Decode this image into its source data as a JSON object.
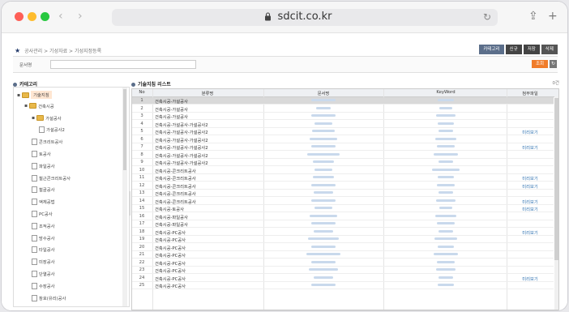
{
  "browser": {
    "url": "sdcit.co.kr"
  },
  "breadcrumb": [
    "공사관리",
    "기성자료",
    "기성지정등록"
  ],
  "top_buttons": {
    "category": "카테고리",
    "new": "신규",
    "save": "저장",
    "delete": "삭제"
  },
  "search": {
    "label": "문서명",
    "value": "",
    "search_button": "조회"
  },
  "left_panel": {
    "title": "카테고리"
  },
  "right_panel": {
    "title": "기술지침 리스트",
    "right_text": "0건"
  },
  "tree": [
    {
      "label": "기술지침",
      "level": 0,
      "type": "folder",
      "selected": true
    },
    {
      "label": "건축시공",
      "level": 1,
      "type": "folder"
    },
    {
      "label": "가설공사",
      "level": 2,
      "type": "folder"
    },
    {
      "label": "가설공사2",
      "level": 3,
      "type": "doc"
    },
    {
      "label": "콘크리트공사",
      "level": 2,
      "type": "doc"
    },
    {
      "label": "토공사",
      "level": 2,
      "type": "doc"
    },
    {
      "label": "파일공사",
      "level": 2,
      "type": "doc"
    },
    {
      "label": "철근콘크리트공사",
      "level": 2,
      "type": "doc"
    },
    {
      "label": "철골공사",
      "level": 2,
      "type": "doc"
    },
    {
      "label": "액체공법",
      "level": 2,
      "type": "doc"
    },
    {
      "label": "PC공사",
      "level": 2,
      "type": "doc"
    },
    {
      "label": "조적공사",
      "level": 2,
      "type": "doc"
    },
    {
      "label": "방수공사",
      "level": 2,
      "type": "doc"
    },
    {
      "label": "타일공사",
      "level": 2,
      "type": "doc"
    },
    {
      "label": "미장공사",
      "level": 2,
      "type": "doc"
    },
    {
      "label": "단열공사",
      "level": 2,
      "type": "doc"
    },
    {
      "label": "수장공사",
      "level": 2,
      "type": "doc"
    },
    {
      "label": "창호(유리)공사",
      "level": 2,
      "type": "doc"
    }
  ],
  "grid": {
    "headers": {
      "no": "No",
      "category": "분류명",
      "doc": "문서명",
      "keyword": "KeyWord",
      "attach": "첨부파일"
    },
    "rows": [
      {
        "no": "1",
        "category": "건축시공-가설공사",
        "attach": ""
      },
      {
        "no": "2",
        "category": "건축시공-가설공사",
        "attach": ""
      },
      {
        "no": "3",
        "category": "건축시공-가설공사",
        "attach": ""
      },
      {
        "no": "4",
        "category": "건축시공-가설공사-가설공사2",
        "attach": ""
      },
      {
        "no": "5",
        "category": "건축시공-가설공사-가설공사2",
        "attach": "미리보기"
      },
      {
        "no": "6",
        "category": "건축시공-가설공사-가설공사2",
        "attach": ""
      },
      {
        "no": "7",
        "category": "건축시공-가설공사-가설공사2",
        "attach": "미리보기"
      },
      {
        "no": "8",
        "category": "건축시공-가설공사-가설공사2",
        "attach": ""
      },
      {
        "no": "9",
        "category": "건축시공-가설공사-가설공사2",
        "attach": ""
      },
      {
        "no": "10",
        "category": "건축시공-콘크리트공사",
        "attach": ""
      },
      {
        "no": "11",
        "category": "건축시공-콘크리트공사",
        "attach": "미리보기"
      },
      {
        "no": "12",
        "category": "건축시공-콘크리트공사",
        "attach": "미리보기"
      },
      {
        "no": "13",
        "category": "건축시공-콘크리트공사",
        "attach": ""
      },
      {
        "no": "14",
        "category": "건축시공-콘크리트공사",
        "attach": "미리보기"
      },
      {
        "no": "15",
        "category": "건축시공-토공사",
        "attach": "미리보기"
      },
      {
        "no": "16",
        "category": "건축시공-파일공사",
        "attach": ""
      },
      {
        "no": "17",
        "category": "건축시공-파일공사",
        "attach": ""
      },
      {
        "no": "18",
        "category": "건축시공-PC공사",
        "attach": "미리보기"
      },
      {
        "no": "19",
        "category": "건축시공-PC공사",
        "attach": ""
      },
      {
        "no": "20",
        "category": "건축시공-PC공사",
        "attach": ""
      },
      {
        "no": "21",
        "category": "건축시공-PC공사",
        "attach": ""
      },
      {
        "no": "22",
        "category": "건축시공-PC공사",
        "attach": ""
      },
      {
        "no": "23",
        "category": "건축시공-PC공사",
        "attach": ""
      },
      {
        "no": "24",
        "category": "건축시공-PC공사",
        "attach": "미리보기"
      },
      {
        "no": "25",
        "category": "건축시공-PC공사",
        "attach": ""
      }
    ]
  }
}
